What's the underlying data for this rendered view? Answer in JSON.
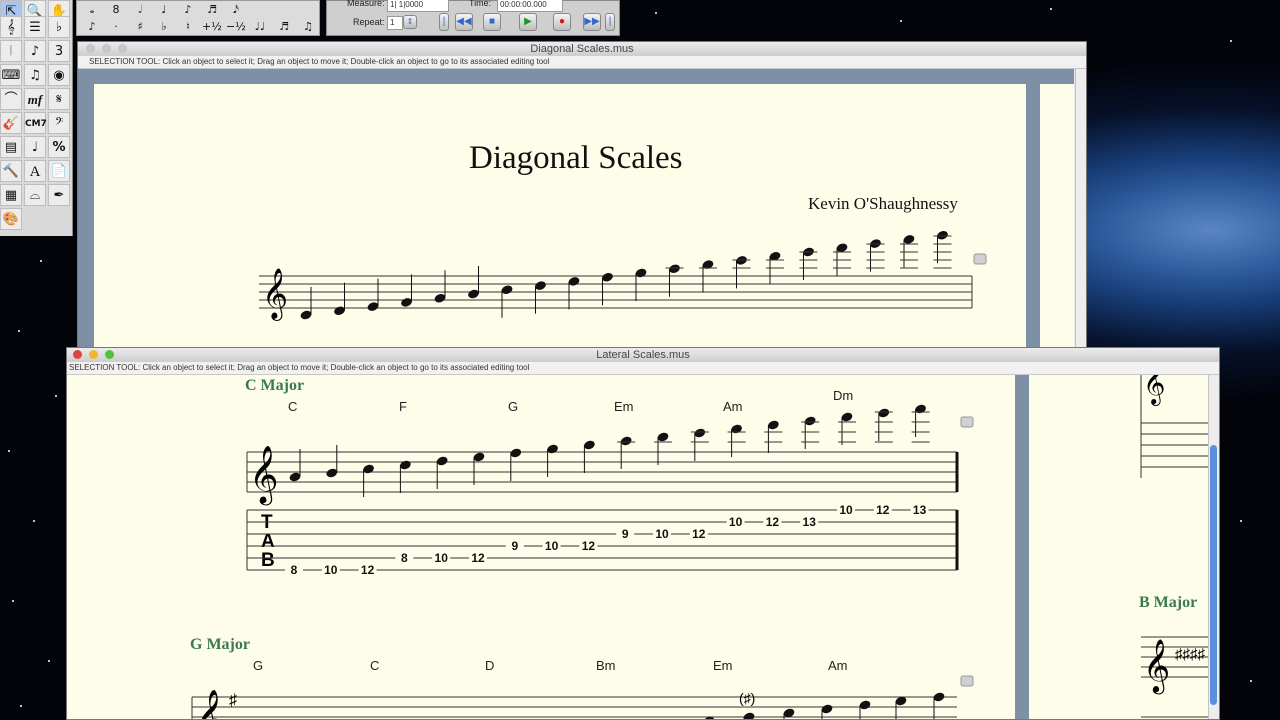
{
  "palette": {
    "tools": [
      "arrow-tool",
      "zoom-tool",
      "hand-tool",
      "staff-tool",
      "page-layout-tool",
      "key-signature-tool",
      "time-signature-tool",
      "clef-tool",
      "measure-tool",
      "speedy-entry-tool",
      "simple-entry-tool",
      "tuplet-tool",
      "smart-shape-tool",
      "expression-tool",
      "repeat-tool",
      "chord-tool",
      "lyrics-tool",
      "text-tool",
      "resize-tool",
      "special-tools",
      "mirror-tool",
      "note-mover-tool",
      "graphics-tool",
      "midi-tool",
      "plugin-tool",
      "articulation-tool",
      "hyperscribe-tool",
      "mixer-tool"
    ],
    "labels": {
      "cm7": "CM7",
      "mf": "mf",
      "percent": "%",
      "text": "A",
      "one": "1",
      "flat_glyph": "♭",
      "sharp_glyph": "♯",
      "eighth": "♪",
      "beam": "♫",
      "pedal": "𝄞"
    }
  },
  "entry_toolbar": {
    "row1": [
      "𝅝",
      "8",
      "𝅗𝅥",
      "♩",
      "♪",
      "♬",
      "𝅘𝅥𝅯"
    ],
    "row2": [
      "♪",
      "·",
      "♯",
      "♭",
      "♮",
      "+½",
      "−½",
      "♩♩",
      "♬",
      "♫"
    ]
  },
  "playback": {
    "measure_label": "Measure:",
    "measure_value": "1| 1|0000",
    "time_label": "Time:",
    "time_value": "00:00:00.000",
    "repeat_label": "Repeat:",
    "repeat_value": "1"
  },
  "window_back": {
    "title": "Diagonal Scales.mus",
    "status": "SELECTION TOOL: Click an object to select it; Drag an object to move it; Double-click an object to go to its associated editing tool",
    "score_title": "Diagonal Scales",
    "composer": "Kevin O'Shaughnessy"
  },
  "window_front": {
    "title": "Lateral Scales.mus",
    "status": "SELECTION TOOL: Click an object to select it; Drag an object to move it; Double-click an object to go to its associated editing tool",
    "sections": [
      {
        "name": "C Major",
        "chords": [
          "C",
          "F",
          "G",
          "Em",
          "Am",
          "Dm"
        ]
      },
      {
        "name": "G Major",
        "chords": [
          "G",
          "C",
          "D",
          "Bm",
          "Em",
          "Am"
        ]
      }
    ],
    "tab_clef": [
      "T",
      "A",
      "B"
    ],
    "tab_numbers": [
      {
        "fret": "8",
        "string": 6
      },
      {
        "fret": "10",
        "string": 6
      },
      {
        "fret": "12",
        "string": 6
      },
      {
        "fret": "8",
        "string": 5
      },
      {
        "fret": "10",
        "string": 5
      },
      {
        "fret": "12",
        "string": 5
      },
      {
        "fret": "9",
        "string": 4
      },
      {
        "fret": "10",
        "string": 4
      },
      {
        "fret": "12",
        "string": 4
      },
      {
        "fret": "9",
        "string": 3
      },
      {
        "fret": "10",
        "string": 3
      },
      {
        "fret": "12",
        "string": 3
      },
      {
        "fret": "10",
        "string": 2
      },
      {
        "fret": "12",
        "string": 2
      },
      {
        "fret": "13",
        "string": 2
      },
      {
        "fret": "10",
        "string": 1
      },
      {
        "fret": "12",
        "string": 1
      },
      {
        "fret": "13",
        "string": 1
      }
    ],
    "side_section": "B Major"
  },
  "colors": {
    "paper": "#fdfde9",
    "section_text": "#3a7a4e",
    "record": "#d81010",
    "play": "#1a9a1a"
  }
}
